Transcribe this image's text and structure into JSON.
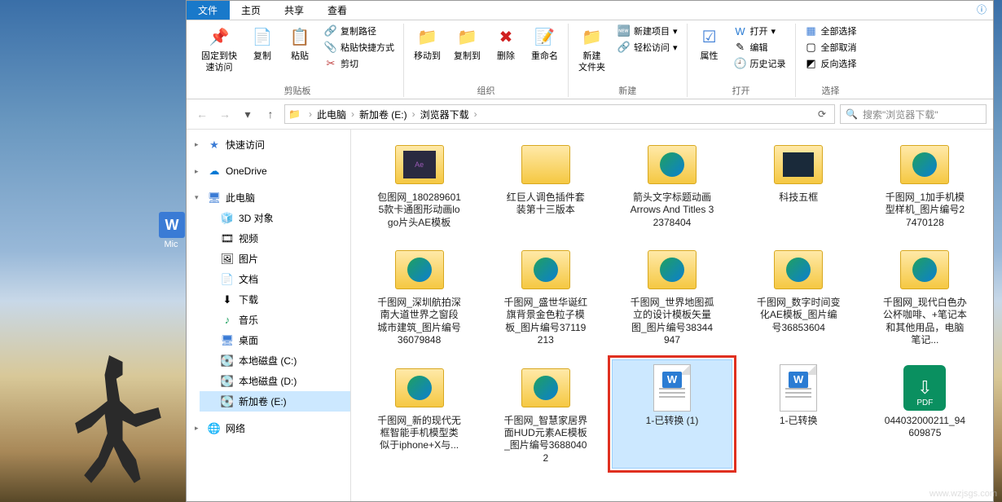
{
  "watermark": "www.wzjsgs.com",
  "desktop": {
    "icon_label": "Mic"
  },
  "tabs": {
    "file": "文件",
    "home": "主页",
    "share": "共享",
    "view": "查看"
  },
  "ribbon": {
    "clipboard": {
      "pin": "固定到快\n速访问",
      "copy": "复制",
      "paste": "粘贴",
      "cut": "剪切",
      "copy_path": "复制路径",
      "paste_shortcut": "粘贴快捷方式",
      "label": "剪贴板"
    },
    "organize": {
      "move_to": "移动到",
      "copy_to": "复制到",
      "delete": "删除",
      "rename": "重命名",
      "label": "组织"
    },
    "new": {
      "new_folder": "新建\n文件夹",
      "new_item": "新建项目",
      "easy_access": "轻松访问",
      "label": "新建"
    },
    "open": {
      "properties": "属性",
      "open": "打开",
      "edit": "编辑",
      "history": "历史记录",
      "label": "打开"
    },
    "select": {
      "select_all": "全部选择",
      "select_none": "全部取消",
      "invert": "反向选择",
      "label": "选择"
    }
  },
  "breadcrumb": {
    "pc": "此电脑",
    "drive": "新加卷 (E:)",
    "folder": "浏览器下载"
  },
  "search": {
    "placeholder": "搜索\"浏览器下载\""
  },
  "sidebar": {
    "quick_access": "快速访问",
    "onedrive": "OneDrive",
    "this_pc": "此电脑",
    "objects3d": "3D 对象",
    "videos": "视频",
    "pictures": "图片",
    "documents": "文档",
    "downloads": "下载",
    "music": "音乐",
    "desktop": "桌面",
    "local_c": "本地磁盘 (C:)",
    "local_d": "本地磁盘 (D:)",
    "new_e": "新加卷 (E:)",
    "network": "网络"
  },
  "files": {
    "f0": "包图网_1802896015款卡通图形动画logo片头AE模板",
    "f1": "红巨人调色插件套装第十三版本",
    "f2": "箭头文字标题动画 Arrows And Titles 32378404",
    "f3": "科技五框",
    "f4": "千图网_1加手机模型样机_图片编号27470128",
    "f5": "千图网_深圳航拍深南大道世界之窗段城市建筑_图片编号36079848",
    "f6": "千图网_盛世华诞红旗背景金色粒子模板_图片编号37119213",
    "f7": "千图网_世界地图孤立的设计模板矢量图_图片编号38344947",
    "f8": "千图网_数字时间变化AE模板_图片编号36853604",
    "f9": "千图网_现代白色办公杯咖啡、+笔记本和其他用品，电脑笔记...",
    "f10": "千图网_新的现代无框智能手机模型类似于iphone+X与...",
    "f11": "千图网_智慧家居界面HUD元素AE模板_图片编号36880402",
    "f12": "1-已转换 (1)",
    "f13": "1-已转换",
    "f14": "044032000211_94609875"
  }
}
